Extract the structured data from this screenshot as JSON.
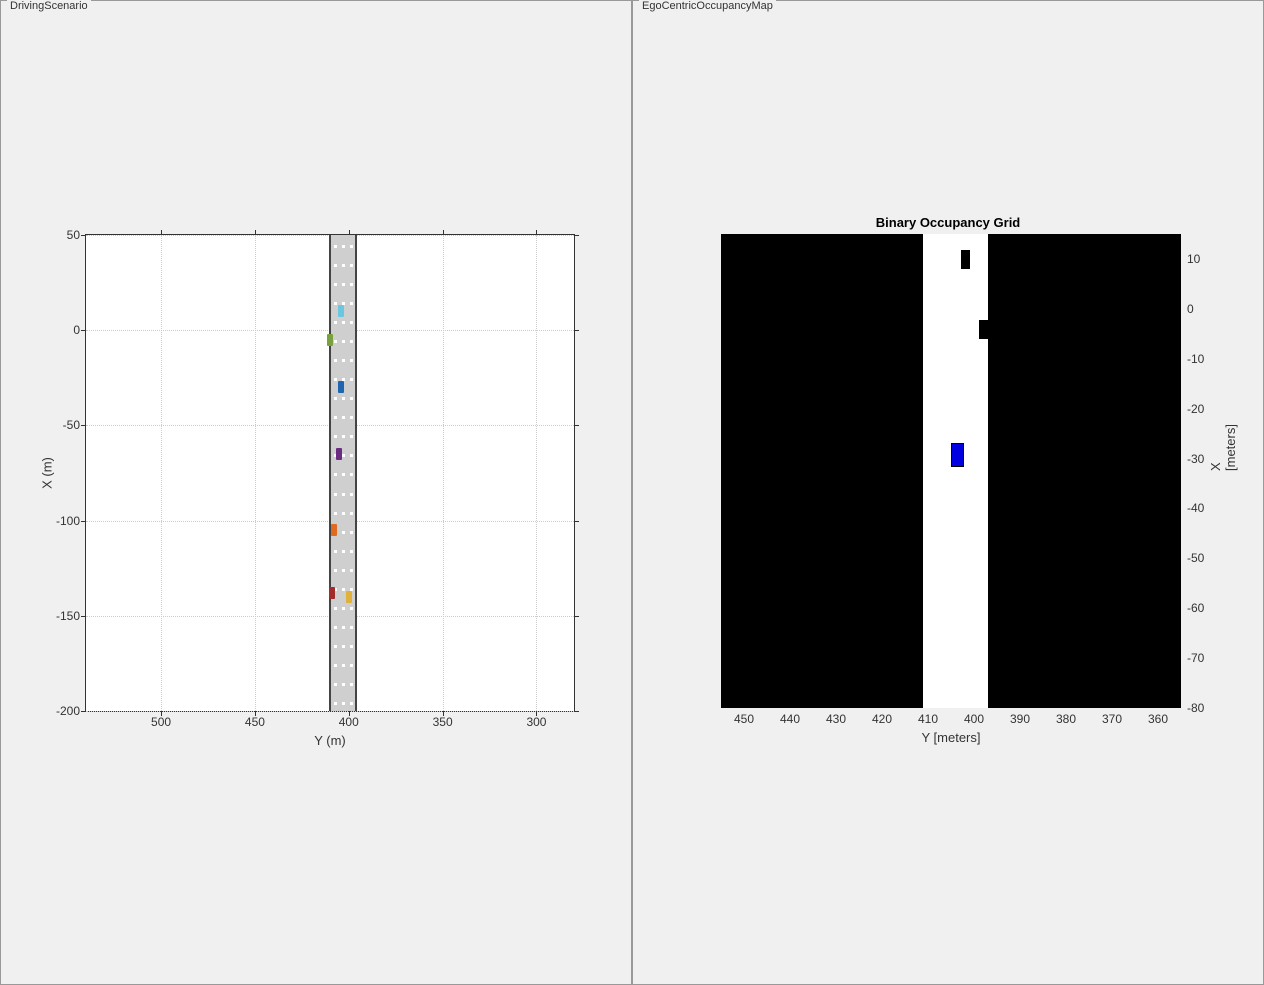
{
  "panels": {
    "left": {
      "label": "DrivingScenario"
    },
    "right": {
      "label": "EgoCentricOccupancyMap"
    }
  },
  "chart_data": [
    {
      "type": "scatter",
      "title": "",
      "xlabel": "Y (m)",
      "ylabel": "X (m)",
      "xlim": [
        540,
        280
      ],
      "ylim": [
        -200,
        50
      ],
      "xticks": [
        500,
        450,
        400,
        350,
        300
      ],
      "yticks": [
        50,
        0,
        -50,
        -100,
        -150,
        -200
      ],
      "road": {
        "y_center": 403,
        "width_m": 15
      },
      "series": [
        {
          "name": "vehicles",
          "points": [
            {
              "y": 404,
              "x": 10,
              "color": "#6bc6e0"
            },
            {
              "y": 410,
              "x": -5,
              "color": "#7aa23c"
            },
            {
              "y": 404,
              "x": -30,
              "color": "#1f66b0"
            },
            {
              "y": 405,
              "x": -65,
              "color": "#6a2d82"
            },
            {
              "y": 408,
              "x": -105,
              "color": "#e06a1f"
            },
            {
              "y": 409,
              "x": -138,
              "color": "#a02c2c"
            },
            {
              "y": 400,
              "x": -140,
              "color": "#e0b23c"
            }
          ]
        }
      ]
    },
    {
      "type": "heatmap",
      "title": "Binary Occupancy Grid",
      "xlabel": "Y [meters]",
      "ylabel": "X [meters]",
      "xlim": [
        455,
        355
      ],
      "ylim": [
        -80,
        15
      ],
      "xticks": [
        450,
        440,
        430,
        420,
        410,
        400,
        390,
        380,
        370,
        360
      ],
      "yticks": [
        10,
        0,
        -10,
        -20,
        -30,
        -40,
        -50,
        -60,
        -70,
        -80
      ],
      "free_corridor": {
        "y_min": 397,
        "y_max": 411
      },
      "obstacles": [
        {
          "y": 402,
          "x": 10
        },
        {
          "y": 398,
          "x": -4
        }
      ],
      "ego": {
        "y": 404,
        "x": -29,
        "color": "#0000e0"
      }
    }
  ]
}
